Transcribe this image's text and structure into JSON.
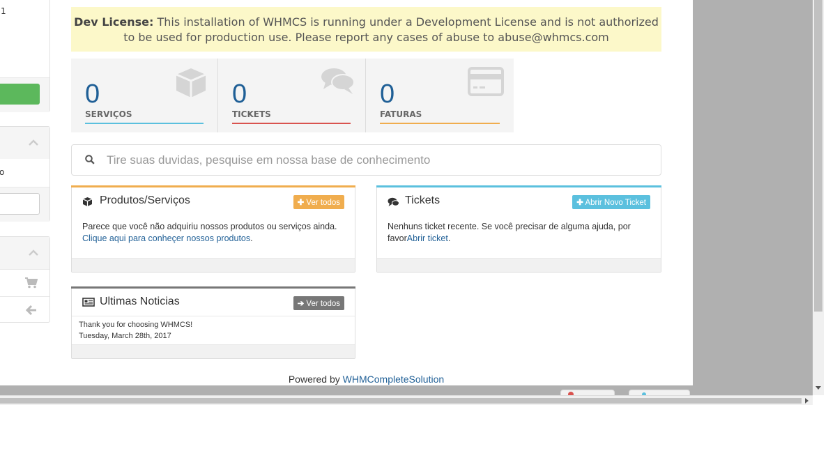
{
  "sidebar": {
    "fragment_number": "1",
    "fragment_text": "o",
    "chevron_up": "up",
    "cart_icon": "shopping-cart-icon",
    "back_icon": "arrow-left-icon"
  },
  "dev_license": {
    "label": "Dev License:",
    "line1": "This installation of WHMCS is running under a Development License and is not authorized",
    "line2": "to be used for production use. Please report any cases of abuse to abuse@whmcs.com"
  },
  "stats": [
    {
      "value": "0",
      "label": "SERVIÇOS",
      "color": "#5bc0de"
    },
    {
      "value": "0",
      "label": "TICKETS",
      "color": "#d9534f"
    },
    {
      "value": "0",
      "label": "FATURAS",
      "color": "#f0ad4e"
    }
  ],
  "search": {
    "placeholder": "Tire suas duvidas, pesquise em nossa base de conhecimento"
  },
  "products_panel": {
    "title": "Produtos/Serviços",
    "button": "Ver todos",
    "body_text": "Parece que você não adquiriu nossos produtos ou serviços ainda.",
    "link": "Clique aqui para conheçer nossos produtos",
    "link_suffix": ".",
    "accent": "#f0ad4e"
  },
  "tickets_panel": {
    "title": "Tickets",
    "button": "Abrir Novo Ticket",
    "body_text": "Nenhuns ticket recente. Se você precisar de alguma ajuda, por favor",
    "link": "Abrir ticket",
    "link_suffix": ".",
    "accent": "#5bc0de"
  },
  "news_panel": {
    "title": "Ultimas Noticias",
    "button": "Ver todos",
    "item_title": "Thank you for choosing WHMCS!",
    "item_date": "Tuesday, March 28th, 2017",
    "accent": "#777777"
  },
  "footer": {
    "prefix": "Powered by",
    "link": "WHMCompleteSolution"
  }
}
